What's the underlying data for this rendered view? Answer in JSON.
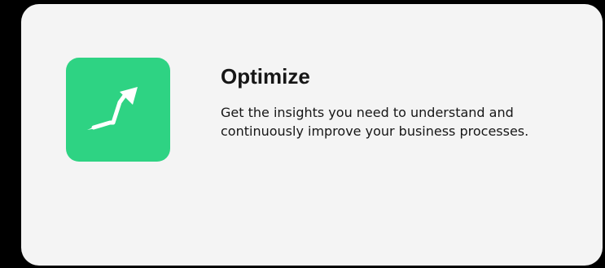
{
  "card": {
    "title": "Optimize",
    "description": "Get the insights you need to understand and continuously improve your business processes.",
    "icon": "trending-up-arrow-icon",
    "accent_color": "#2ed383"
  }
}
